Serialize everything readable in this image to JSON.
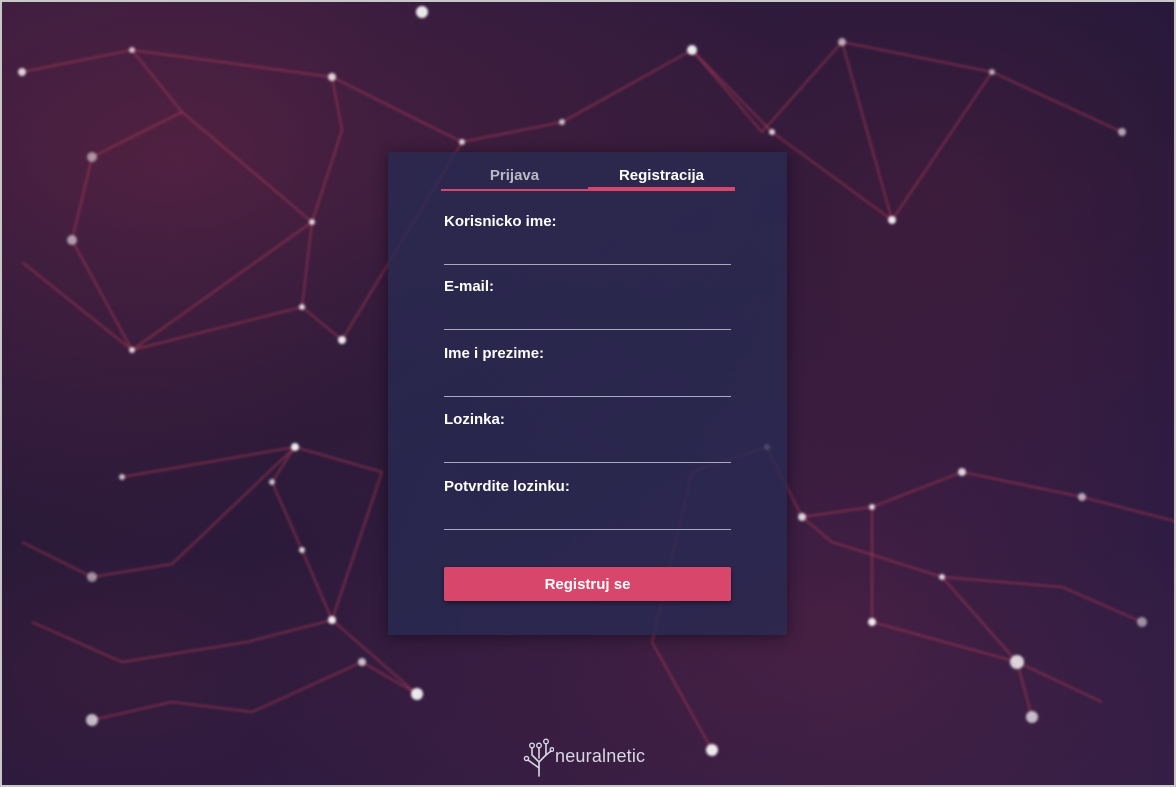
{
  "tabs": {
    "login_label": "Prijava",
    "register_label": "Registracija",
    "active": "register"
  },
  "form": {
    "username_label": "Korisnicko ime:",
    "username_value": "",
    "email_label": "E-mail:",
    "email_value": "",
    "fullname_label": "Ime i prezime:",
    "fullname_value": "",
    "password_label": "Lozinka:",
    "password_value": "",
    "confirm_password_label": "Potvrdite lozinku:",
    "confirm_password_value": "",
    "submit_label": "Registruj se"
  },
  "brand": {
    "name": "neuralnetic",
    "icon": "circuit-tree-icon"
  },
  "colors": {
    "accent": "#d9466b",
    "card": "#282a52",
    "background": "#151637"
  }
}
